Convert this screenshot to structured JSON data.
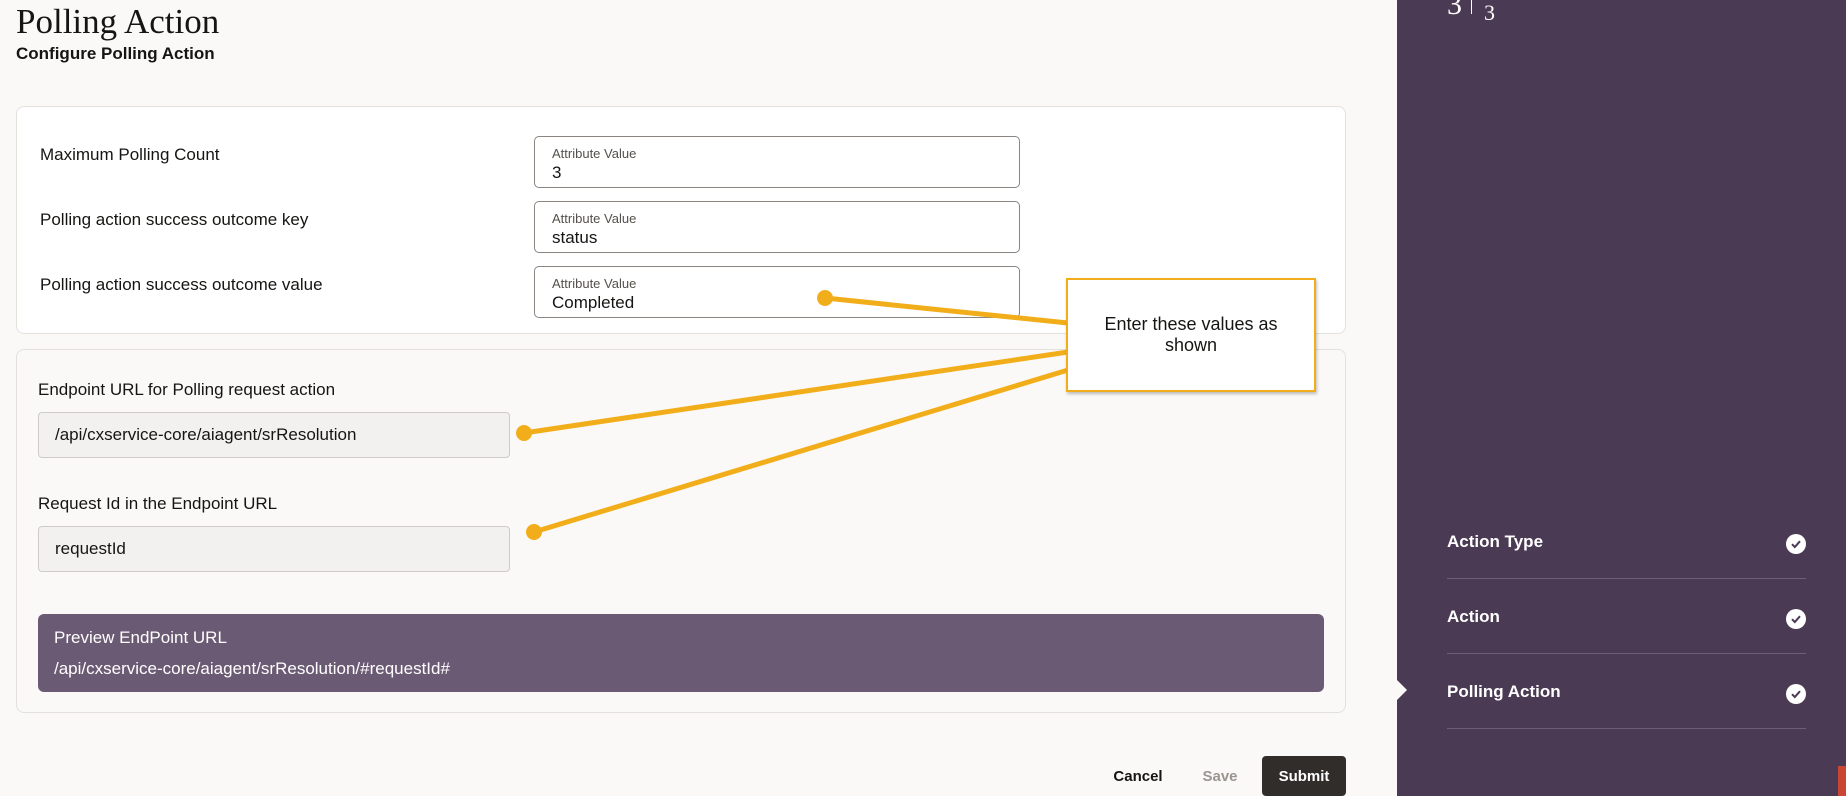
{
  "header": {
    "title": "Polling Action",
    "subtitle": "Configure Polling Action"
  },
  "attributes": {
    "caption": "Attribute Value",
    "rows": [
      {
        "label": "Maximum Polling Count",
        "value": "3"
      },
      {
        "label": "Polling action success outcome key",
        "value": "status"
      },
      {
        "label": "Polling action success outcome value",
        "value": "Completed"
      }
    ]
  },
  "endpoint": {
    "url_label": "Endpoint URL for Polling request action",
    "url_value": "/api/cxservice-core/aiagent/srResolution",
    "request_label": "Request Id in the Endpoint URL",
    "request_value": "requestId",
    "preview_label": "Preview EndPoint URL",
    "preview_value": "/api/cxservice-core/aiagent/srResolution/#requestId#"
  },
  "footer": {
    "cancel": "Cancel",
    "save": "Save",
    "submit": "Submit"
  },
  "sidebar": {
    "step_current": "3",
    "step_total": "3",
    "items": [
      {
        "label": "Action Type",
        "status": "completed"
      },
      {
        "label": "Action",
        "status": "completed"
      },
      {
        "label": "Polling Action",
        "status": "completed"
      }
    ]
  },
  "annotation": {
    "text": "Enter these values as shown",
    "color": "#f2ae1a"
  },
  "colors": {
    "sidebar_bg": "#4b3a53",
    "preview_bg": "#6b5a73",
    "submit_bg": "#312d2a"
  }
}
